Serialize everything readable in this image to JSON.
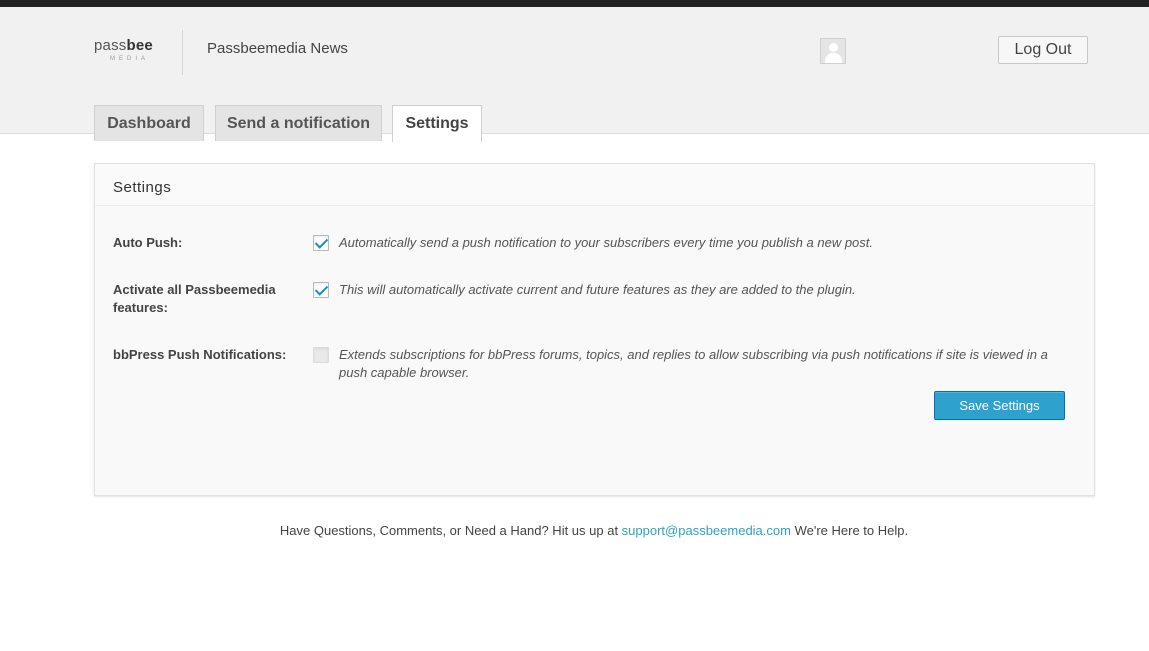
{
  "header": {
    "logo": {
      "word_light": "pass",
      "word_bold": "bee",
      "sub": "MEDIA"
    },
    "site_name": "Passbeemedia News",
    "logout_label": "Log Out"
  },
  "tabs": [
    {
      "label": "Dashboard",
      "active": false
    },
    {
      "label": "Send a notification",
      "active": false
    },
    {
      "label": "Settings",
      "active": true
    }
  ],
  "settings_panel": {
    "title": "Settings",
    "rows": [
      {
        "label": "Auto Push:",
        "checked": true,
        "enabled": true,
        "description": "Automatically send a push notification to your subscribers every time you publish a new post."
      },
      {
        "label": "Activate all Passbeemedia features:",
        "checked": true,
        "enabled": true,
        "description": "This will automatically activate current and future features as they are added to the plugin."
      },
      {
        "label": "bbPress Push Notifications:",
        "checked": false,
        "enabled": false,
        "description": "Extends subscriptions for bbPress forums, topics, and replies to allow subscribing via push notifications if site is viewed in a push capable browser."
      }
    ],
    "save_label": "Save Settings"
  },
  "footer": {
    "text_before": "Have Questions, Comments, or Need a Hand? Hit us up at ",
    "email": "support@passbeemedia.com",
    "text_after": " We're Here to Help."
  },
  "colors": {
    "accent": "#2ea2cc",
    "checkmark": "#1e8cbe",
    "header_bg": "#f1f1f1",
    "topbar": "#222222"
  }
}
